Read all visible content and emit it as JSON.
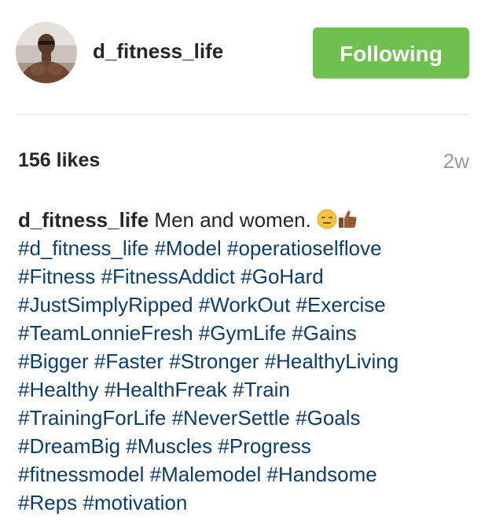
{
  "post_header": {
    "username": "d_fitness_life",
    "follow_button_label": "Following",
    "avatar_icon": "profile-photo"
  },
  "colors": {
    "follow_button_bg": "#70c050",
    "hashtag": "#0f3d6b",
    "text": "#262626",
    "muted": "#999999"
  },
  "stats": {
    "likes": "156 likes",
    "time_ago": "2w"
  },
  "caption": {
    "author": "d_fitness_life",
    "text": "Men and women.",
    "emojis": [
      "expressionless-face-emoji",
      "thumbs-up-emoji"
    ],
    "hashtag_lines": [
      [
        "#d_fitness_life",
        "#Model",
        "#operatioselflove"
      ],
      [
        "#Fitness",
        "#FitnessAddict",
        "#GoHard"
      ],
      [
        "#JustSimplyRipped",
        "#WorkOut",
        "#Exercise"
      ],
      [
        "#TeamLonnieFresh",
        "#GymLife",
        "#Gains"
      ],
      [
        "#Bigger",
        "#Faster",
        "#Stronger",
        "#HealthyLiving"
      ],
      [
        "#Healthy",
        "#HealthFreak",
        "#Train"
      ],
      [
        "#TrainingForLife",
        "#NeverSettle",
        "#Goals"
      ],
      [
        "#DreamBig",
        "#Muscles",
        "#Progress"
      ],
      [
        "#fitnessmodel",
        "#Malemodel",
        "#Handsome"
      ],
      [
        "#Reps",
        "#motivation"
      ]
    ]
  }
}
